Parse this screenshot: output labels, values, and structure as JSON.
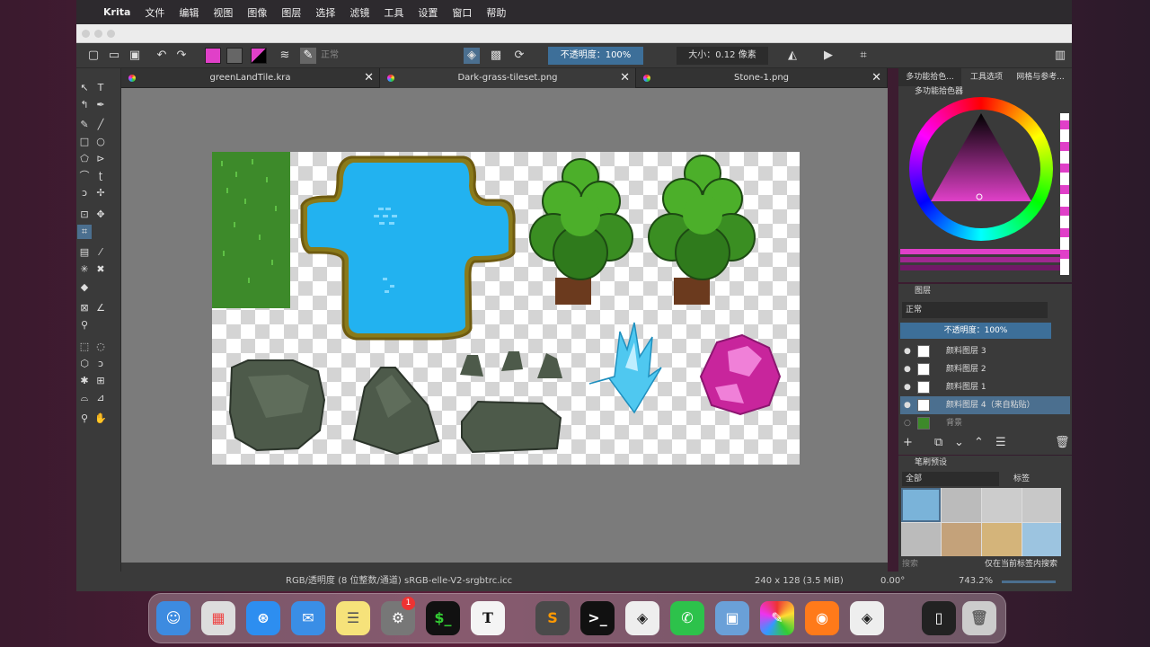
{
  "menubar": {
    "app": "Krita",
    "items": [
      "文件",
      "编辑",
      "视图",
      "图像",
      "图层",
      "选择",
      "滤镜",
      "工具",
      "设置",
      "窗口",
      "帮助"
    ]
  },
  "toolbar": {
    "blend_mode": "正常",
    "opacity": "不透明度：100%",
    "size": "大小：0.12 像素"
  },
  "tabs": [
    {
      "title": "greenLandTile.kra"
    },
    {
      "title": "Dark-grass-tileset.png"
    },
    {
      "title": "Stone-1.png"
    }
  ],
  "docker_tabs": [
    "多功能拾色...",
    "工具选项",
    "网格与参考..."
  ],
  "color_selector": {
    "title": "多功能拾色器"
  },
  "layers": {
    "title": "图层",
    "blend_mode": "正常",
    "opacity": "不透明度：100%",
    "items": [
      {
        "name": "颜料图层 3",
        "selected": false
      },
      {
        "name": "颜料图层 2",
        "selected": false
      },
      {
        "name": "颜料图层 1",
        "selected": false
      },
      {
        "name": "颜料图层 4（来自粘贴）",
        "selected": true
      },
      {
        "name": "背景",
        "selected": false
      }
    ]
  },
  "brush_presets": {
    "title": "笔刷预设",
    "filter": "全部",
    "tag_label": "标签",
    "search_placeholder": "搜索",
    "checkbox_label": "仅在当前标签内搜索"
  },
  "status": {
    "color_info": "RGB/透明度 (8 位整数/通道)  sRGB-elle-V2-srgbtrc.icc",
    "dimensions": "240 x 128 (3.5 MiB)",
    "rotation": "0.00°",
    "zoom": "743.2%"
  },
  "colors": {
    "accent": "#4b6f8f",
    "foreground": "#e040c8",
    "grass": "#3d8a2a",
    "water": "#22b2f0"
  }
}
